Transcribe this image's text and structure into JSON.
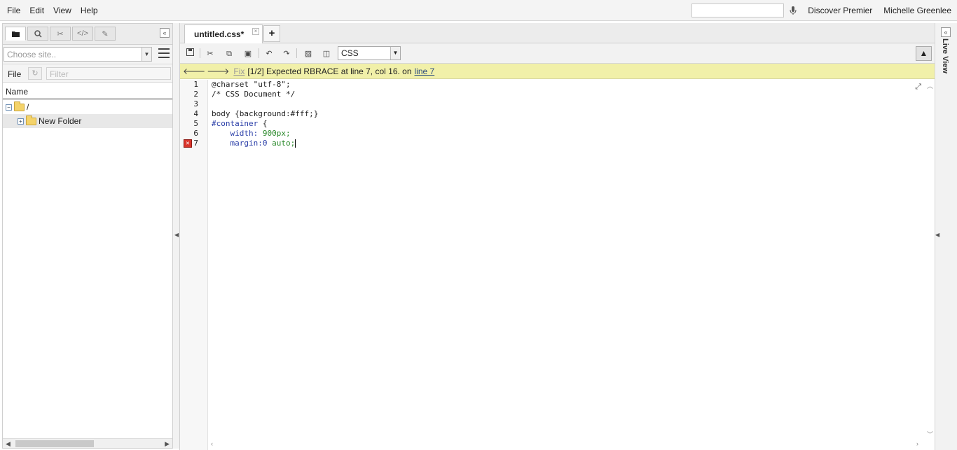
{
  "menu": {
    "file": "File",
    "edit": "Edit",
    "view": "View",
    "help": "Help"
  },
  "topbar": {
    "search_placeholder": "",
    "discover": "Discover Premier",
    "user": "Michelle Greenlee"
  },
  "left_panel": {
    "site_placeholder": "Choose site..",
    "file_label": "File",
    "filter_placeholder": "Filter",
    "name_header": "Name",
    "tree": [
      {
        "label": "/"
      },
      {
        "label": "New Folder"
      }
    ]
  },
  "editor": {
    "tab_name": "untitled.css*",
    "language": "CSS",
    "error": {
      "fix": "Fix",
      "message": "[1/2] Expected RBRACE at line 7, col 16. on",
      "link": "line 7"
    },
    "line_numbers": [
      "1",
      "2",
      "3",
      "4",
      "5",
      "6",
      "7"
    ],
    "code": {
      "l1": "@charset \"utf-8\";",
      "l2": "/* CSS Document */",
      "l4a": "body {background:#fff;}",
      "l5a": "#container",
      "l5b": " {",
      "l6a": "    width: ",
      "l6b": "900px;",
      "l7a": "    margin:",
      "l7b": "0",
      "l7c": " auto;"
    }
  },
  "right_panel": {
    "live_view": "Live View"
  },
  "colors": {
    "error_bar": "#f1f0a9",
    "error_marker": "#d9342b"
  }
}
